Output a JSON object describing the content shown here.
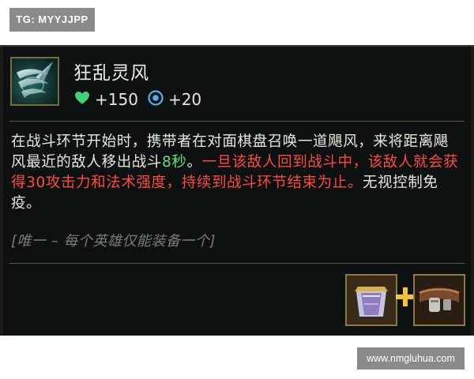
{
  "watermarks": {
    "top": "TG: MYYJJPP",
    "bottom": "www.nmgluhua.com"
  },
  "item": {
    "icon": "tornado-wing-icon",
    "name": "狂乱灵风",
    "stats": [
      {
        "icon": "heart-icon",
        "value": "+150",
        "color": "#3fd07a"
      },
      {
        "icon": "mana-orb-icon",
        "value": "+20",
        "color": "#4ab6e8"
      }
    ],
    "description": {
      "part1": "在战斗环节开始时，携带者在对面棋盘召唤一道飓风，来将距离飓风最近的敌人移出战斗",
      "duration": "8秒",
      "part2": "。",
      "red": "一旦该敌人回到战斗中，该敌人就会获得30攻击力和法术强度，持续到战斗环节结束为止。",
      "part3": "无视控制免疫。"
    },
    "unique_note": "[唯一 – 每个英雄仅能装备一个]",
    "recipe": {
      "components": [
        "negatron-cloak-icon",
        "giants-belt-icon"
      ],
      "plus_icon": "plus-icon"
    }
  },
  "colors": {
    "background": "#0d1112",
    "text": "#e9e6de",
    "green_highlight": "#5fe07f",
    "red_highlight": "#ff4a3b",
    "gold_border": "#8a7a3c",
    "muted": "#7b7b74"
  }
}
